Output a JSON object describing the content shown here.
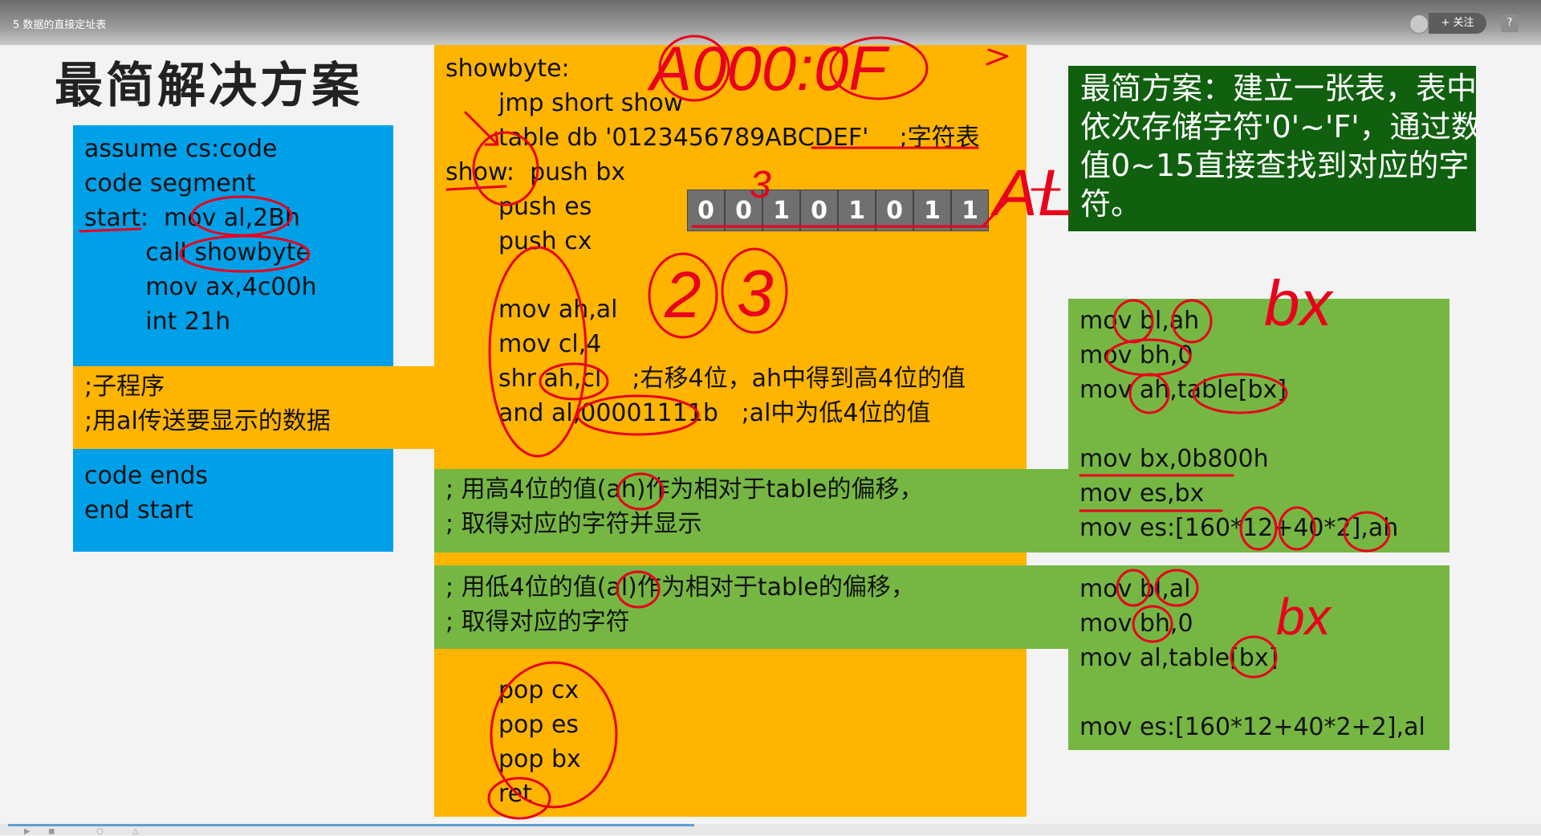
{
  "window": {
    "title": "5 数据的直接定址表",
    "follow_label": "+ 关注",
    "help_label": "?"
  },
  "slide": {
    "title": "最简解决方案",
    "blue_code": [
      "assume cs:code",
      "code segment",
      "start:  mov al,2Bh",
      "        call showbyte",
      "        mov ax,4c00h",
      "        int 21h"
    ],
    "subroutine_note": [
      ";子程序",
      ";用al传送要显示的数据"
    ],
    "blue_end": [
      "code ends",
      "end start"
    ],
    "showbyte_label": "showbyte:",
    "jmp_line": "jmp short show",
    "table_line": "table db '0123456789ABCDEF'    ;字符表",
    "show_line": "show:  push bx",
    "push_es": "push es",
    "push_cx": "push cx",
    "mid_code": [
      "mov ah,al",
      "mov cl,4",
      "shr ah,cl    ;右移4位，ah中得到高4位的值",
      "and al,00001111b   ;al中为低4位的值"
    ],
    "high_note": [
      "; 用高4位的值(ah)作为相对于table的偏移，",
      "; 取得对应的字符并显示"
    ],
    "low_note": [
      "; 用低4位的值(al)作为相对于table的偏移，",
      "; 取得对应的字符"
    ],
    "pop_code": [
      "pop cx",
      "pop es",
      "pop bx",
      "ret"
    ],
    "bits": [
      "0",
      "0",
      "1",
      "0",
      "1",
      "0",
      "1",
      "1"
    ],
    "dark_green_text": "最简方案：建立一张表，表中依次存储字符'0'~'F'，通过数值0~15直接查找到对应的字符。",
    "right_top_code": [
      "mov bl,ah",
      "mov bh,0",
      "mov ah,table[bx]",
      "",
      "mov bx,0b800h",
      "mov es,bx",
      "mov es:[160*12+40*2],ah"
    ],
    "right_bottom_code": [
      "mov bl,al",
      "mov bh,0",
      "mov al,table[bx]",
      "",
      "mov es:[160*12+40*2+2],al"
    ],
    "handwritten": {
      "addr": "A000:0F",
      "al_label": "AL",
      "bx_label1": "bx",
      "bx_label2": "bx",
      "num2": "2",
      "num3": "3",
      "mark3": "3"
    }
  },
  "player": {
    "progress": 0.45
  },
  "colors": {
    "blue": "#00a0e9",
    "orange": "#ffb400",
    "green": "#76b743",
    "dark_green": "#10600f",
    "ink": "#e8001c"
  }
}
